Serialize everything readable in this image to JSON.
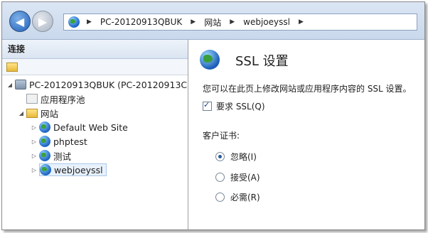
{
  "breadcrumb": [
    "PC-20120913QBUK",
    "网站",
    "webjoeyssl"
  ],
  "left": {
    "header": "连接",
    "tree": [
      {
        "label": "PC-20120913QBUK (PC-20120913C",
        "icon": "computer-icon"
      },
      {
        "label": "应用程序池",
        "icon": "app-pool-icon"
      },
      {
        "label": "网站",
        "icon": "sites-folder-icon"
      },
      {
        "label": "Default Web Site",
        "icon": "globe-icon"
      },
      {
        "label": "phptest",
        "icon": "globe-icon"
      },
      {
        "label": "测试",
        "icon": "globe-icon"
      },
      {
        "label": "webjoeyssl",
        "icon": "globe-icon"
      }
    ]
  },
  "right": {
    "title": "SSL 设置",
    "description": "您可以在此页上修改网站或应用程序内容的 SSL 设置。",
    "require_ssl": "要求 SSL(Q)",
    "client_cert_label": "客户证书:",
    "options": [
      "忽略(I)",
      "接受(A)",
      "必需(R)"
    ],
    "selected_option": "忽略(I)"
  }
}
